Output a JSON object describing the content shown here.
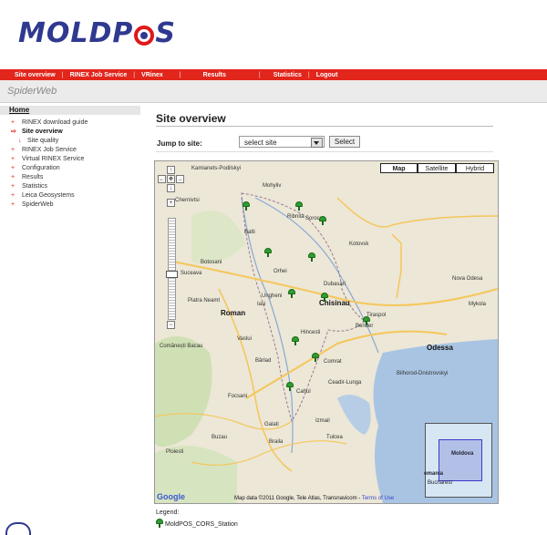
{
  "logo": {
    "part1": "MOLDP",
    "part2": "S"
  },
  "nav": [
    {
      "label": "Site overview"
    },
    {
      "label": "RINEX Job Service"
    },
    {
      "label": "VRinex"
    },
    {
      "label": "Results"
    },
    {
      "label": "Statistics"
    },
    {
      "label": "Logout"
    }
  ],
  "subtitle": "SpiderWeb",
  "sidebar": {
    "home": "Home",
    "items": [
      {
        "label": "RINEX download guide"
      },
      {
        "label": "Site overview"
      },
      {
        "label": "Site quality"
      },
      {
        "label": "RINEX Job Service"
      },
      {
        "label": "Virtual RINEX Service"
      },
      {
        "label": "Configuration"
      },
      {
        "label": "Results"
      },
      {
        "label": "Statistics"
      },
      {
        "label": "Leica Geosystems"
      },
      {
        "label": "SpiderWeb"
      }
    ]
  },
  "main": {
    "title": "Site overview",
    "jump_label": "Jump to site:",
    "select_value": "select site",
    "select_button": "Select"
  },
  "map": {
    "types": [
      "Map",
      "Satellite",
      "Hybrid"
    ],
    "places": {
      "chisinau": "Chisinau",
      "odessa": "Odessa",
      "iasi": "Iasi",
      "galati": "Galati",
      "tulcea": "Tulcea",
      "braila": "Braila",
      "vaslui": "Vaslui",
      "roman": "Roman",
      "bacau": "Comănești Bacau",
      "focsani": "Focsani",
      "barlad": "Bârlad",
      "botosani": "Botosani",
      "suceava": "Suceava",
      "balti": "Balti",
      "soroca": "Soroca",
      "tiraspol": "Tiraspol",
      "bender": "Bender",
      "comrat": "Comrat",
      "cahul": "Cahul",
      "hincesti": "Hincesti",
      "ceadir": "Ceadir-Lunga",
      "kamianets": "Kamianets-Podilskyi",
      "mohyliv": "Mohyliv",
      "chernivtsi": "Chernivtsi",
      "nova_odesa": "Nova Odesa",
      "mykola": "Mykola",
      "piatra": "Piatra Neamt",
      "ploiesti": "Ploiesti",
      "buzau": "Buzau",
      "kotovsk": "Kotovsk",
      "dubasari": "Dubasari",
      "ribnita": "Ribnita",
      "orhei": "Orhei",
      "ungheni": "Ungheni",
      "izmail": "Izmail",
      "bilhorod": "Bilhorod-Dnistrovskyi"
    },
    "inset": {
      "moldova": "Moldova",
      "romania": "omania",
      "bucharest": "Bucharest"
    },
    "copyright": "Map data ©2011 Google, Tele Atlas, Transnavicom - ",
    "terms": "Terms of Use",
    "google": "Google"
  },
  "legend": {
    "title": "Legend:",
    "item": "MoldPOS_CORS_Station"
  },
  "colors": {
    "brand_red": "#e2261c",
    "brand_blue": "#2f3990",
    "marker_green": "#2f9d2f"
  }
}
